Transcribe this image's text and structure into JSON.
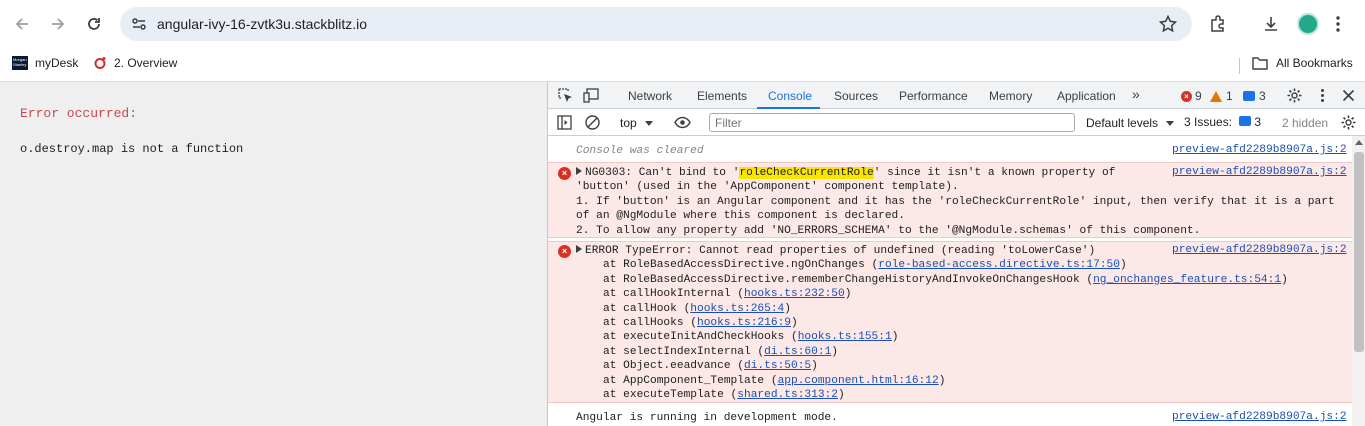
{
  "browser": {
    "url": "angular-ivy-16-zvtk3u.stackblitz.io",
    "bookmarks": [
      {
        "label": "myDesk",
        "logo_text": "Morgan Stanley"
      },
      {
        "label": "2. Overview"
      }
    ],
    "all_bookmarks_label": "All Bookmarks"
  },
  "page": {
    "error_title": "Error occurred:",
    "error_message": "o.destroy.map is not a function"
  },
  "devtools": {
    "tabs": [
      "Network",
      "Elements",
      "Console",
      "Sources",
      "Performance",
      "Memory",
      "Application"
    ],
    "active_tab": "Console",
    "more_tabs": "»",
    "counts": {
      "errors": "9",
      "warnings": "1",
      "messages": "3"
    },
    "context": "top",
    "filter_placeholder": "Filter",
    "levels": "Default levels",
    "issues_label": "3 Issues:",
    "issues_count": "3",
    "hidden": "2 hidden",
    "colors": {
      "accent": "#1a73e8",
      "error": "#d93025",
      "warning": "#e37400",
      "error_bg": "#fce8e6"
    }
  },
  "console": {
    "cleared": "Console was cleared",
    "cleared_src": "preview-afd2289b8907a.js:2",
    "error1": {
      "prefix": "NG0303: Can't bind to '",
      "highlight": "roleCheckCurrentRole",
      "suffix": "' since it isn't a known property of",
      "line2": "'button' (used in the 'AppComponent' component template).",
      "line3": "1. If 'button' is an Angular component and it has the 'roleCheckCurrentRole' input, then verify that it is a part",
      "line4": "of an @NgModule where this component is declared.",
      "line5": "2. To allow any property add 'NO_ERRORS_SCHEMA' to the '@NgModule.schemas' of this component.",
      "src": "preview-afd2289b8907a.js:2"
    },
    "error2": {
      "head": "ERROR TypeError: Cannot read properties of undefined (reading 'toLowerCase')",
      "src": "preview-afd2289b8907a.js:2",
      "stack": [
        {
          "text": "at RoleBasedAccessDirective.ngOnChanges (",
          "link": "role-based-access.directive.ts:17:50",
          "end": ")"
        },
        {
          "text": "at RoleBasedAccessDirective.rememberChangeHistoryAndInvokeOnChangesHook (",
          "link": "ng_onchanges_feature.ts:54:1",
          "end": ")"
        },
        {
          "text": "at callHookInternal (",
          "link": "hooks.ts:232:50",
          "end": ")"
        },
        {
          "text": "at callHook (",
          "link": "hooks.ts:265:4",
          "end": ")"
        },
        {
          "text": "at callHooks (",
          "link": "hooks.ts:216:9",
          "end": ")"
        },
        {
          "text": "at executeInitAndCheckHooks (",
          "link": "hooks.ts:155:1",
          "end": ")"
        },
        {
          "text": "at selectIndexInternal (",
          "link": "di.ts:60:1",
          "end": ")"
        },
        {
          "text": "at Object.eeadvance (",
          "link": "di.ts:50:5",
          "end": ")"
        },
        {
          "text": "at AppComponent_Template (",
          "link": "app.component.html:16:12",
          "end": ")"
        },
        {
          "text": "at executeTemplate (",
          "link": "shared.ts:313:2",
          "end": ")"
        }
      ]
    },
    "info": "Angular is running in development mode.",
    "info_src": "preview-afd2289b8907a.js:2"
  }
}
